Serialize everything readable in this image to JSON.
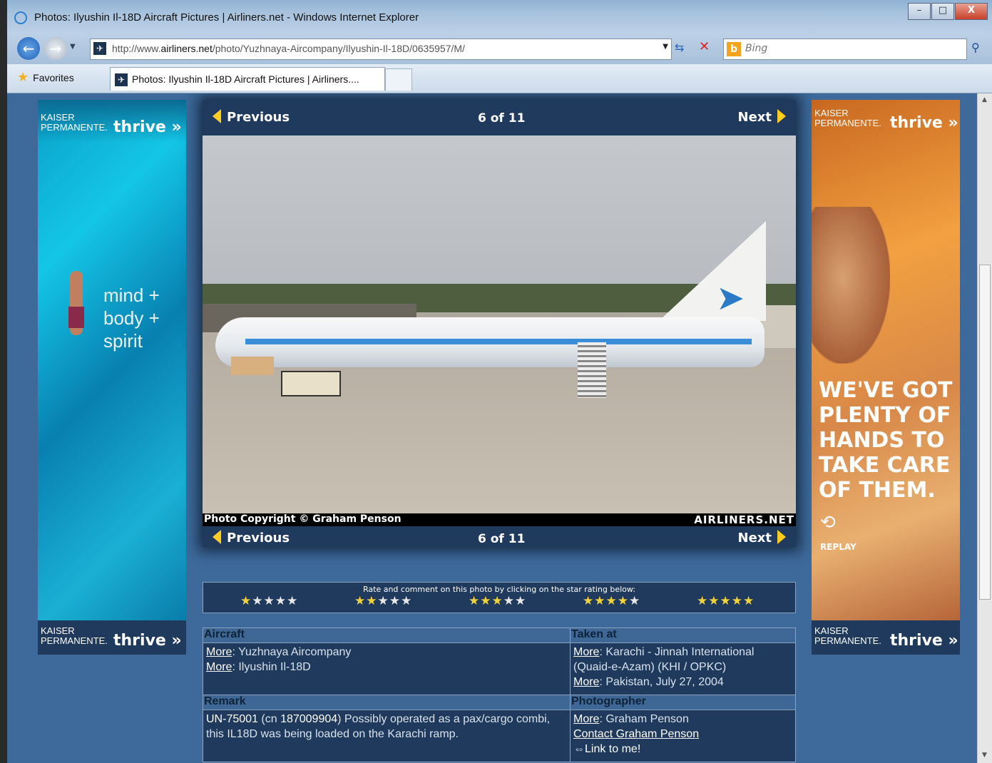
{
  "window": {
    "title": "Photos: Ilyushin Il-18D Aircraft Pictures | Airliners.net - Windows Internet Explorer",
    "min": "–",
    "max": "□",
    "close": "X"
  },
  "address": {
    "url_prefix": "http://www.",
    "url_domain": "airliners.net",
    "url_path": "/photo/Yuzhnaya-Aircompany/Ilyushin-Il-18D/0635957/M/",
    "search_placeholder": "Bing"
  },
  "tabs": {
    "favorites": "Favorites",
    "active_tab": "Photos: Ilyushin Il-18D Aircraft Pictures | Airliners...."
  },
  "ad_left": {
    "brand_line1": "KAISER",
    "brand_line2": "PERMANENTE.",
    "thrive": "thrive »",
    "slogan_1": "mind +",
    "slogan_2": "body +",
    "slogan_3": "spirit"
  },
  "ad_right": {
    "brand_line1": "KAISER",
    "brand_line2": "PERMANENTE.",
    "thrive": "thrive »",
    "headline_1": "WE'VE GOT",
    "headline_2": "PLENTY OF",
    "headline_3": "HANDS TO",
    "headline_4": "TAKE CARE",
    "headline_5": "OF THEM.",
    "replay": "REPLAY"
  },
  "photo_nav": {
    "previous": "Previous",
    "next": "Next",
    "counter": "6 of 11"
  },
  "photo": {
    "copyright": "Photo Copyright © Graham Penson",
    "logo": "AIRLINERS.NET"
  },
  "rating": {
    "prompt": "Rate and comment on this photo by clicking on the star rating below:",
    "groups": [
      {
        "filled": "★",
        "empty": "★★★★"
      },
      {
        "filled": "★★",
        "empty": "★★★"
      },
      {
        "filled": "★★★",
        "empty": "★★"
      },
      {
        "filled": "★★★★",
        "empty": "★"
      },
      {
        "filled": "★★★★★",
        "empty": ""
      }
    ]
  },
  "info": {
    "aircraft_header": "Aircraft",
    "taken_header": "Taken at",
    "remark_header": "Remark",
    "photographer_header": "Photographer",
    "more": "More",
    "airline": "Yuzhnaya Aircompany",
    "type": "Ilyushin Il-18D",
    "location": "Karachi - Jinnah International (Quaid-e-Azam) (KHI / OPKC)",
    "date": "Pakistan, July 27, 2004",
    "reg": "UN-75001",
    "cn_prefix": "(cn ",
    "cn": "187009904",
    "remark_text": ") Possibly operated as a pax/cargo combi, this IL18D was being loaded on the Karachi ramp.",
    "photographer": "Graham Penson",
    "contact": "Contact Graham Penson",
    "link": "Link to me!"
  }
}
